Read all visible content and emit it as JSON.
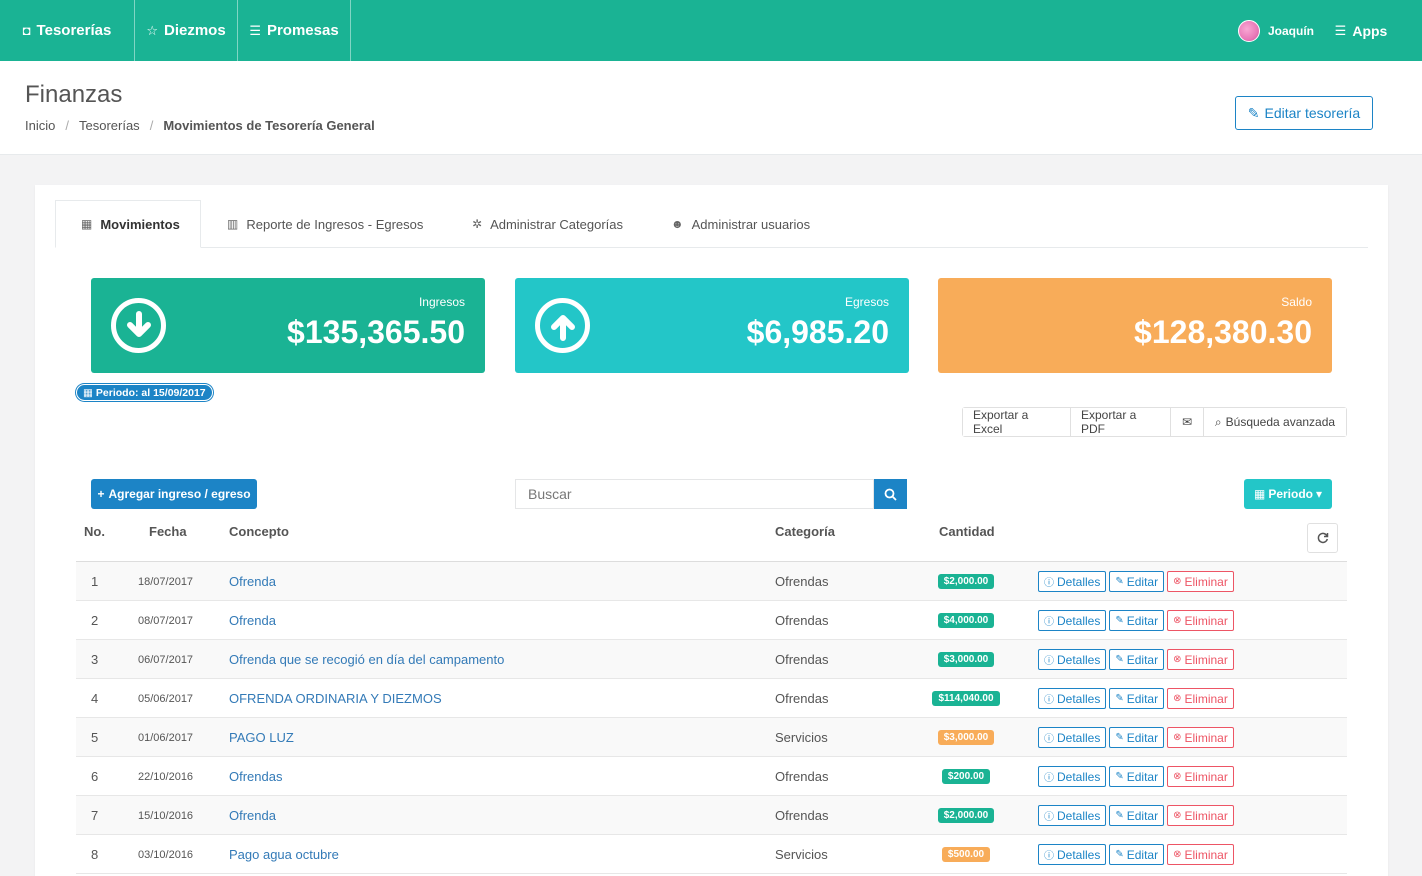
{
  "nav": {
    "items": [
      {
        "label": "Tesorerías",
        "icon": "money-icon",
        "glyph": "◘"
      },
      {
        "label": "Diezmos",
        "icon": "star-icon",
        "glyph": "☆"
      },
      {
        "label": "Promesas",
        "icon": "list-icon",
        "glyph": "☰"
      }
    ],
    "user_name": "Joaquín",
    "apps_label": "Apps",
    "apps_glyph": "☰"
  },
  "header": {
    "title": "Finanzas",
    "breadcrumb": [
      "Inicio",
      "Tesorerías",
      "Movimientos de Tesorería General"
    ],
    "edit_label": "Editar tesorería",
    "edit_glyph": "✎"
  },
  "tabs": [
    {
      "label": "Movimientos",
      "icon": "table-icon",
      "glyph": "▦",
      "active": true
    },
    {
      "label": "Reporte de Ingresos - Egresos",
      "icon": "bar-chart-icon",
      "glyph": "▥",
      "active": false
    },
    {
      "label": "Administrar Categorías",
      "icon": "gear-icon",
      "glyph": "✲",
      "active": false
    },
    {
      "label": "Administrar usuarios",
      "icon": "users-icon",
      "glyph": "☻",
      "active": false
    }
  ],
  "summary": {
    "ingresos": {
      "label": "Ingresos",
      "value": "$135,365.50",
      "color": "#1ab394"
    },
    "egresos": {
      "label": "Egresos",
      "value": "$6,985.20",
      "color": "#23c6c8"
    },
    "saldo": {
      "label": "Saldo",
      "value": "$128,380.30",
      "color": "#f8ac59"
    }
  },
  "period_badge": "Periodo: al 15/09/2017",
  "export": {
    "excel": "Exportar a Excel",
    "pdf": "Exportar a PDF",
    "advanced": "Búsqueda avanzada"
  },
  "toolbar": {
    "add_label": "Agregar ingreso / egreso",
    "search_placeholder": "Buscar",
    "periodo_label": "Periodo"
  },
  "table": {
    "headers": [
      "No.",
      "Fecha",
      "Concepto",
      "Categoría",
      "Cantidad"
    ],
    "actions": {
      "details": "Detalles",
      "edit": "Editar",
      "delete": "Eliminar"
    },
    "rows": [
      {
        "no": "1",
        "fecha": "18/07/2017",
        "concepto": "Ofrenda",
        "categoria": "Ofrendas",
        "cantidad": "$2,000.00",
        "tipo": "in"
      },
      {
        "no": "2",
        "fecha": "08/07/2017",
        "concepto": "Ofrenda",
        "categoria": "Ofrendas",
        "cantidad": "$4,000.00",
        "tipo": "in"
      },
      {
        "no": "3",
        "fecha": "06/07/2017",
        "concepto": "Ofrenda que se recogió en día del campamento",
        "categoria": "Ofrendas",
        "cantidad": "$3,000.00",
        "tipo": "in"
      },
      {
        "no": "4",
        "fecha": "05/06/2017",
        "concepto": "OFRENDA ORDINARIA Y DIEZMOS",
        "categoria": "Ofrendas",
        "cantidad": "$114,040.00",
        "tipo": "in"
      },
      {
        "no": "5",
        "fecha": "01/06/2017",
        "concepto": "PAGO LUZ",
        "categoria": "Servicios",
        "cantidad": "$3,000.00",
        "tipo": "out"
      },
      {
        "no": "6",
        "fecha": "22/10/2016",
        "concepto": "Ofrendas",
        "categoria": "Ofrendas",
        "cantidad": "$200.00",
        "tipo": "in"
      },
      {
        "no": "7",
        "fecha": "15/10/2016",
        "concepto": "Ofrenda",
        "categoria": "Ofrendas",
        "cantidad": "$2,000.00",
        "tipo": "in"
      },
      {
        "no": "8",
        "fecha": "03/10/2016",
        "concepto": "Pago agua octubre",
        "categoria": "Servicios",
        "cantidad": "$500.00",
        "tipo": "out"
      }
    ]
  }
}
